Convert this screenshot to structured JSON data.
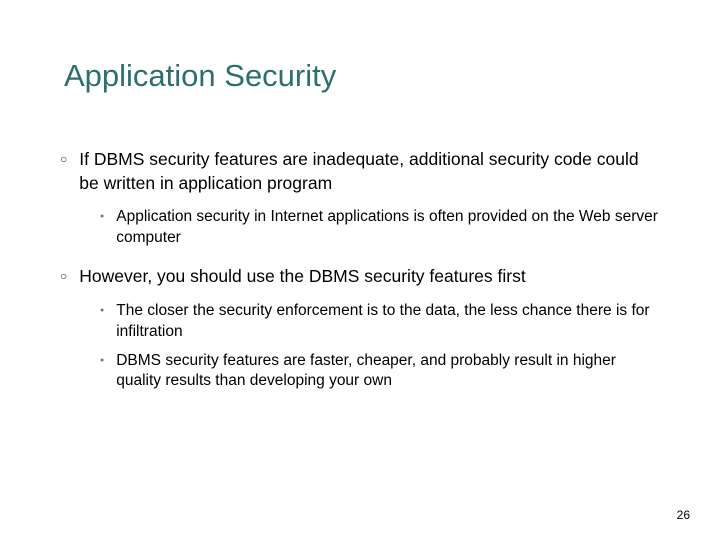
{
  "title": "Application Security",
  "items": [
    {
      "text": "If DBMS security features are inadequate, additional security code could be written in application program",
      "sub": [
        {
          "text": "Application security in Internet applications is often provided on the Web server computer"
        }
      ]
    },
    {
      "text": "However, you should use the DBMS security features first",
      "sub": [
        {
          "text": "The closer the security enforcement is to the data, the less chance there is for infiltration"
        },
        {
          "text": "DBMS security features are faster, cheaper, and probably result in higher quality results than developing your own"
        }
      ]
    }
  ],
  "page_number": "26"
}
